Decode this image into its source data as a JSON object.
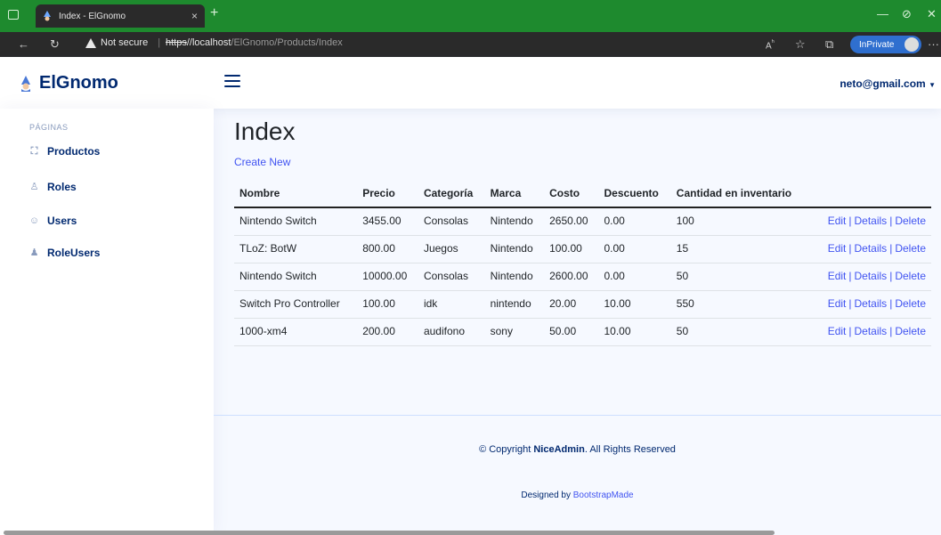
{
  "browser": {
    "tab_title": "Index - ElGnomo",
    "tab_close": "×",
    "new_tab": "+",
    "security_label": "Not secure",
    "url_protocol": "https",
    "url_host": "//localhost",
    "url_path": "/ElGnomo/Products/Index",
    "inprivate_label": "InPrivate",
    "more": "···"
  },
  "header": {
    "logo_text": "ElGnomo",
    "user_email": "neto@gmail.com"
  },
  "sidebar": {
    "heading": "PÁGINAS",
    "items": [
      {
        "label": "Productos",
        "icon": "products-icon"
      },
      {
        "label": "Roles",
        "icon": "roles-icon"
      },
      {
        "label": "Users",
        "icon": "users-icon"
      },
      {
        "label": "RoleUsers",
        "icon": "roleusers-icon"
      }
    ]
  },
  "main": {
    "title": "Index",
    "create_new": "Create New",
    "columns": [
      "Nombre",
      "Precio",
      "Categoría",
      "Marca",
      "Costo",
      "Descuento",
      "Cantidad en inventario"
    ],
    "rows": [
      [
        "Nintendo Switch",
        "3455.00",
        "Consolas",
        "Nintendo",
        "2650.00",
        "0.00",
        "100"
      ],
      [
        "TLoZ: BotW",
        "800.00",
        "Juegos",
        "Nintendo",
        "100.00",
        "0.00",
        "15"
      ],
      [
        "Nintendo Switch",
        "10000.00",
        "Consolas",
        "Nintendo",
        "2600.00",
        "0.00",
        "50"
      ],
      [
        "Switch Pro Controller",
        "100.00",
        "idk",
        "nintendo",
        "20.00",
        "10.00",
        "550"
      ],
      [
        "1000-xm4",
        "200.00",
        "audifono",
        "sony",
        "50.00",
        "10.00",
        "50"
      ]
    ],
    "actions": {
      "edit": "Edit",
      "details": "Details",
      "delete": "Delete",
      "sep": "|"
    }
  },
  "footer": {
    "copyright_prefix": "© Copyright ",
    "copyright_brand": "NiceAdmin",
    "copyright_suffix": ". All Rights Reserved",
    "designed_prefix": "Designed by ",
    "designed_link": "BootstrapMade"
  },
  "colors": {
    "brand": "#012970",
    "accent": "#4154f1",
    "titlebar": "#1e8a2e"
  }
}
